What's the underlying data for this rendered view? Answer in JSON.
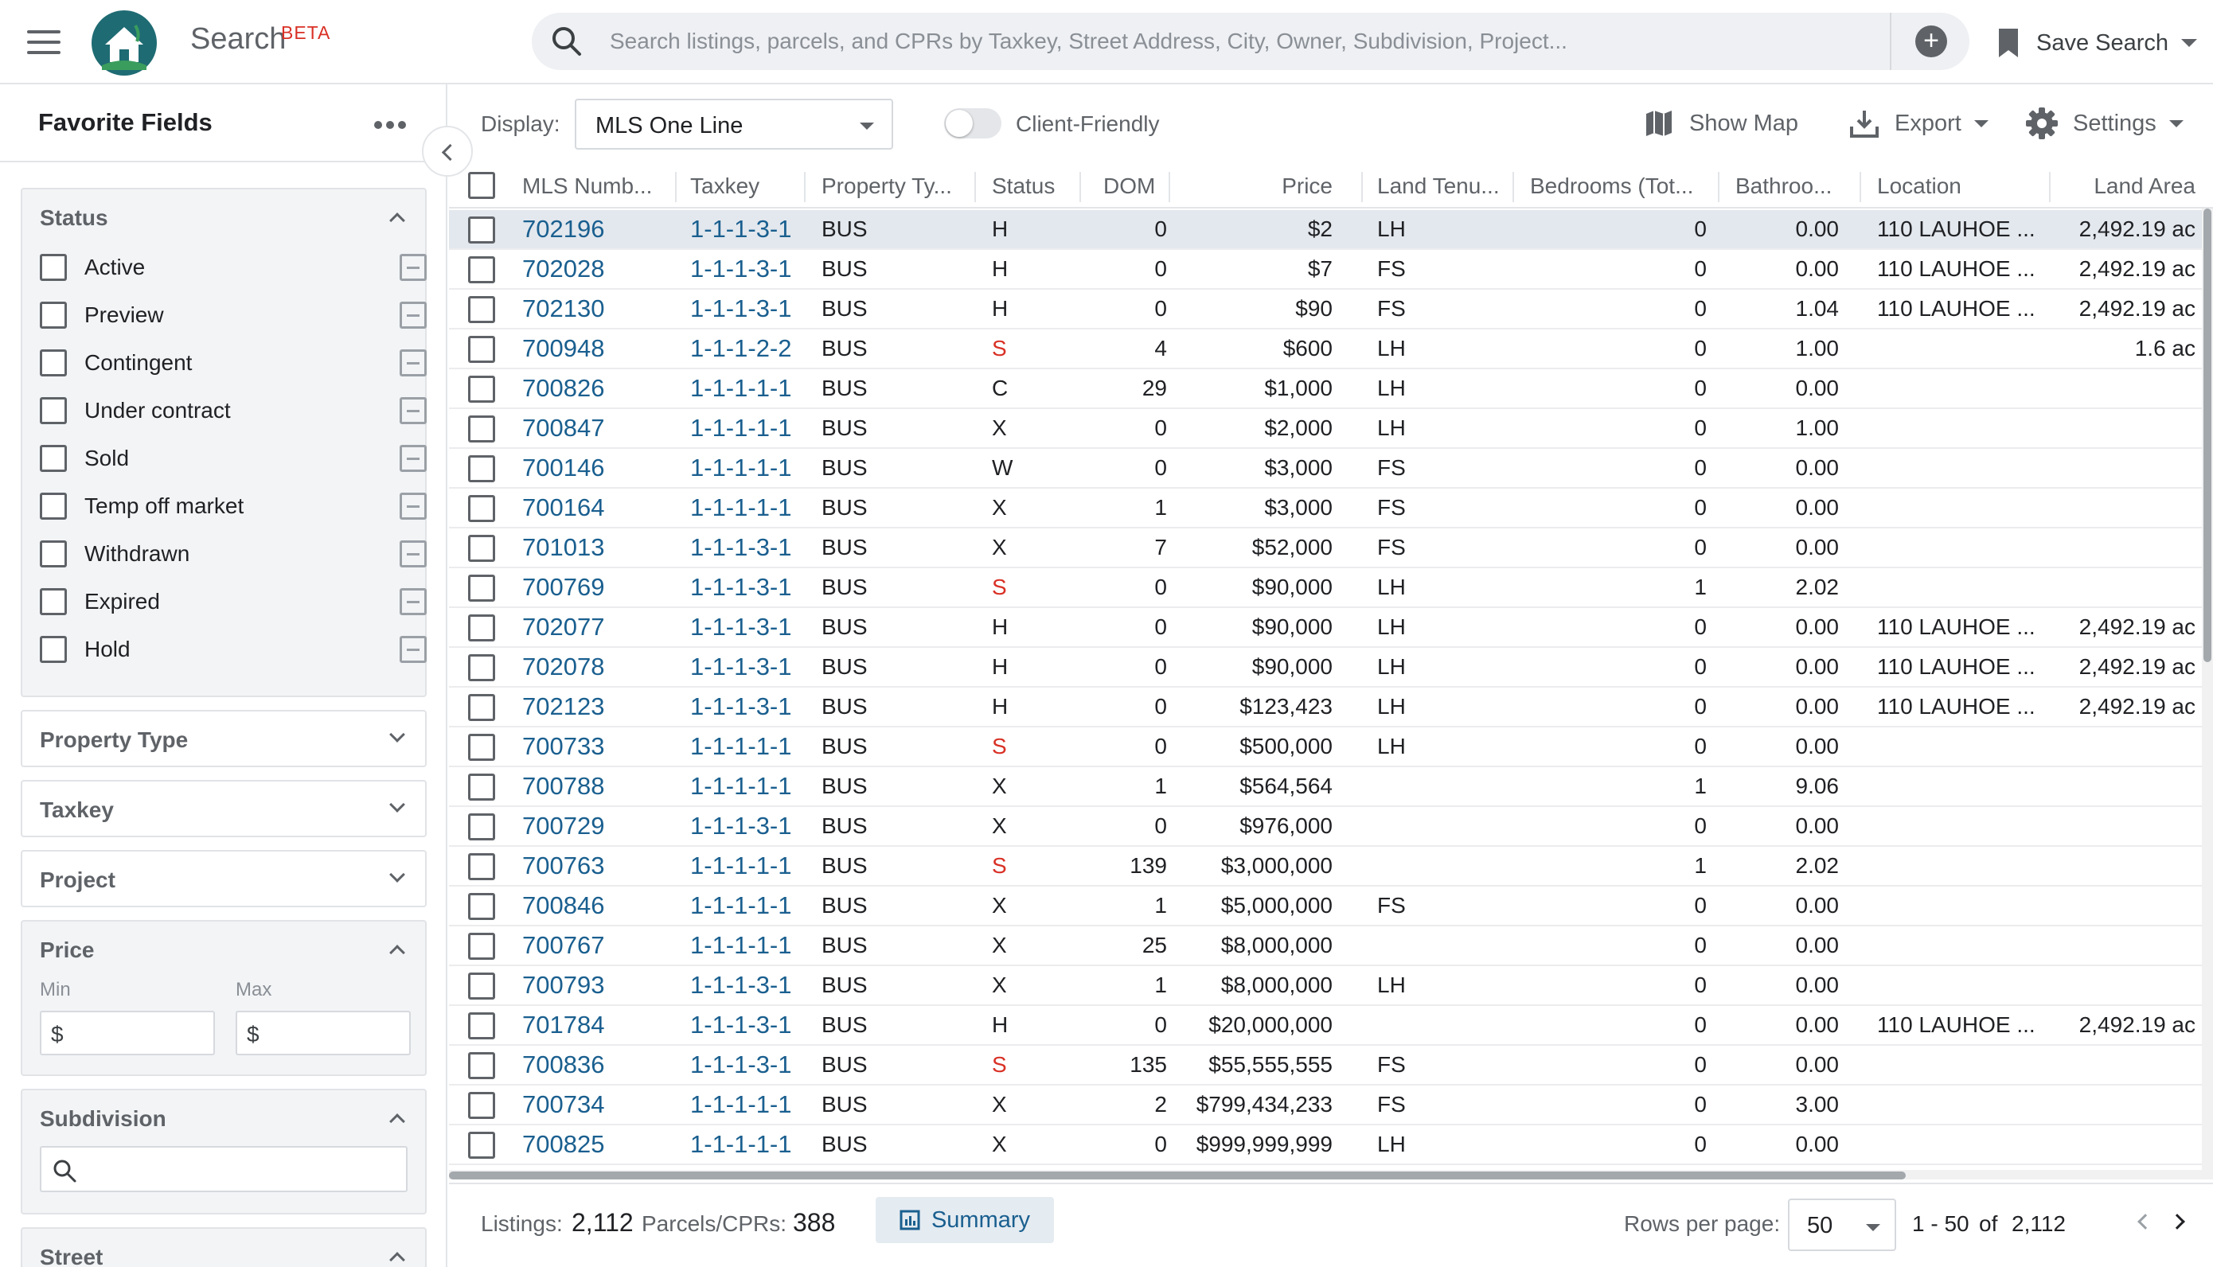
{
  "header": {
    "app_title": "Search",
    "beta_badge": "BETA",
    "search_placeholder": "Search listings, parcels, and CPRs by Taxkey, Street Address, City, Owner, Subdivision, Project...",
    "save_search_label": "Save Search"
  },
  "sidebar": {
    "title": "Favorite Fields",
    "status": {
      "title": "Status",
      "options": [
        "Active",
        "Preview",
        "Contingent",
        "Under contract",
        "Sold",
        "Temp off market",
        "Withdrawn",
        "Expired",
        "Hold"
      ]
    },
    "property_type_title": "Property Type",
    "taxkey_title": "Taxkey",
    "project_title": "Project",
    "price": {
      "title": "Price",
      "min_label": "Min",
      "max_label": "Max",
      "currency": "$"
    },
    "subdivision_title": "Subdivision",
    "street_title": "Street"
  },
  "toolbar": {
    "display_label": "Display:",
    "display_value": "MLS One Line",
    "client_friendly_label": "Client-Friendly",
    "show_map_label": "Show Map",
    "export_label": "Export",
    "settings_label": "Settings"
  },
  "table": {
    "columns": [
      "MLS Numb...",
      "Taxkey",
      "Property Ty...",
      "Status",
      "DOM",
      "Price",
      "Land Tenu...",
      "Bedrooms (Tot...",
      "Bathroo...",
      "Location",
      "Land Area"
    ],
    "rows": [
      {
        "mls": "702196",
        "taxkey": "1-1-1-3-1",
        "ptype": "BUS",
        "status": "H",
        "dom": "0",
        "price": "$2",
        "tenure": "LH",
        "beds": "0",
        "baths": "0.00",
        "location": "110 LAUHOE ...",
        "area": "2,492.19 ac"
      },
      {
        "mls": "702028",
        "taxkey": "1-1-1-3-1",
        "ptype": "BUS",
        "status": "H",
        "dom": "0",
        "price": "$7",
        "tenure": "FS",
        "beds": "0",
        "baths": "0.00",
        "location": "110 LAUHOE ...",
        "area": "2,492.19 ac"
      },
      {
        "mls": "702130",
        "taxkey": "1-1-1-3-1",
        "ptype": "BUS",
        "status": "H",
        "dom": "0",
        "price": "$90",
        "tenure": "FS",
        "beds": "0",
        "baths": "1.04",
        "location": "110 LAUHOE ...",
        "area": "2,492.19 ac"
      },
      {
        "mls": "700948",
        "taxkey": "1-1-1-2-2",
        "ptype": "BUS",
        "status": "S",
        "dom": "4",
        "price": "$600",
        "tenure": "LH",
        "beds": "0",
        "baths": "1.00",
        "location": "",
        "area": "1.6 ac"
      },
      {
        "mls": "700826",
        "taxkey": "1-1-1-1-1",
        "ptype": "BUS",
        "status": "C",
        "dom": "29",
        "price": "$1,000",
        "tenure": "LH",
        "beds": "0",
        "baths": "0.00",
        "location": "",
        "area": ""
      },
      {
        "mls": "700847",
        "taxkey": "1-1-1-1-1",
        "ptype": "BUS",
        "status": "X",
        "dom": "0",
        "price": "$2,000",
        "tenure": "LH",
        "beds": "0",
        "baths": "1.00",
        "location": "",
        "area": ""
      },
      {
        "mls": "700146",
        "taxkey": "1-1-1-1-1",
        "ptype": "BUS",
        "status": "W",
        "dom": "0",
        "price": "$3,000",
        "tenure": "FS",
        "beds": "0",
        "baths": "0.00",
        "location": "",
        "area": ""
      },
      {
        "mls": "700164",
        "taxkey": "1-1-1-1-1",
        "ptype": "BUS",
        "status": "X",
        "dom": "1",
        "price": "$3,000",
        "tenure": "FS",
        "beds": "0",
        "baths": "0.00",
        "location": "",
        "area": ""
      },
      {
        "mls": "701013",
        "taxkey": "1-1-1-3-1",
        "ptype": "BUS",
        "status": "X",
        "dom": "7",
        "price": "$52,000",
        "tenure": "FS",
        "beds": "0",
        "baths": "0.00",
        "location": "",
        "area": ""
      },
      {
        "mls": "700769",
        "taxkey": "1-1-1-3-1",
        "ptype": "BUS",
        "status": "S",
        "dom": "0",
        "price": "$90,000",
        "tenure": "LH",
        "beds": "1",
        "baths": "2.02",
        "location": "",
        "area": ""
      },
      {
        "mls": "702077",
        "taxkey": "1-1-1-3-1",
        "ptype": "BUS",
        "status": "H",
        "dom": "0",
        "price": "$90,000",
        "tenure": "LH",
        "beds": "0",
        "baths": "0.00",
        "location": "110 LAUHOE ...",
        "area": "2,492.19 ac"
      },
      {
        "mls": "702078",
        "taxkey": "1-1-1-3-1",
        "ptype": "BUS",
        "status": "H",
        "dom": "0",
        "price": "$90,000",
        "tenure": "LH",
        "beds": "0",
        "baths": "0.00",
        "location": "110 LAUHOE ...",
        "area": "2,492.19 ac"
      },
      {
        "mls": "702123",
        "taxkey": "1-1-1-3-1",
        "ptype": "BUS",
        "status": "H",
        "dom": "0",
        "price": "$123,423",
        "tenure": "LH",
        "beds": "0",
        "baths": "0.00",
        "location": "110 LAUHOE ...",
        "area": "2,492.19 ac"
      },
      {
        "mls": "700733",
        "taxkey": "1-1-1-1-1",
        "ptype": "BUS",
        "status": "S",
        "dom": "0",
        "price": "$500,000",
        "tenure": "LH",
        "beds": "0",
        "baths": "0.00",
        "location": "",
        "area": ""
      },
      {
        "mls": "700788",
        "taxkey": "1-1-1-1-1",
        "ptype": "BUS",
        "status": "X",
        "dom": "1",
        "price": "$564,564",
        "tenure": "",
        "beds": "1",
        "baths": "9.06",
        "location": "",
        "area": ""
      },
      {
        "mls": "700729",
        "taxkey": "1-1-1-3-1",
        "ptype": "BUS",
        "status": "X",
        "dom": "0",
        "price": "$976,000",
        "tenure": "",
        "beds": "0",
        "baths": "0.00",
        "location": "",
        "area": ""
      },
      {
        "mls": "700763",
        "taxkey": "1-1-1-1-1",
        "ptype": "BUS",
        "status": "S",
        "dom": "139",
        "price": "$3,000,000",
        "tenure": "",
        "beds": "1",
        "baths": "2.02",
        "location": "",
        "area": ""
      },
      {
        "mls": "700846",
        "taxkey": "1-1-1-1-1",
        "ptype": "BUS",
        "status": "X",
        "dom": "1",
        "price": "$5,000,000",
        "tenure": "FS",
        "beds": "0",
        "baths": "0.00",
        "location": "",
        "area": ""
      },
      {
        "mls": "700767",
        "taxkey": "1-1-1-1-1",
        "ptype": "BUS",
        "status": "X",
        "dom": "25",
        "price": "$8,000,000",
        "tenure": "",
        "beds": "0",
        "baths": "0.00",
        "location": "",
        "area": ""
      },
      {
        "mls": "700793",
        "taxkey": "1-1-1-3-1",
        "ptype": "BUS",
        "status": "X",
        "dom": "1",
        "price": "$8,000,000",
        "tenure": "LH",
        "beds": "0",
        "baths": "0.00",
        "location": "",
        "area": ""
      },
      {
        "mls": "701784",
        "taxkey": "1-1-1-3-1",
        "ptype": "BUS",
        "status": "H",
        "dom": "0",
        "price": "$20,000,000",
        "tenure": "",
        "beds": "0",
        "baths": "0.00",
        "location": "110 LAUHOE ...",
        "area": "2,492.19 ac"
      },
      {
        "mls": "700836",
        "taxkey": "1-1-1-3-1",
        "ptype": "BUS",
        "status": "S",
        "dom": "135",
        "price": "$55,555,555",
        "tenure": "FS",
        "beds": "0",
        "baths": "0.00",
        "location": "",
        "area": ""
      },
      {
        "mls": "700734",
        "taxkey": "1-1-1-1-1",
        "ptype": "BUS",
        "status": "X",
        "dom": "2",
        "price": "$799,434,233",
        "tenure": "FS",
        "beds": "0",
        "baths": "3.00",
        "location": "",
        "area": ""
      },
      {
        "mls": "700825",
        "taxkey": "1-1-1-1-1",
        "ptype": "BUS",
        "status": "X",
        "dom": "0",
        "price": "$999,999,999",
        "tenure": "LH",
        "beds": "0",
        "baths": "0.00",
        "location": "",
        "area": ""
      }
    ]
  },
  "footer": {
    "listings_label": "Listings:",
    "listings_count": "2,112",
    "parcels_label": "Parcels/CPRs:",
    "parcels_count": "388",
    "summary_label": "Summary",
    "rows_per_page_label": "Rows per page:",
    "rows_per_page_value": "50",
    "range_text": "1 - 50",
    "of_label": "of",
    "total_text": "2,112"
  },
  "colors": {
    "link": "#1a5f8f",
    "status_sold": "#d93025",
    "beta": "#d93025",
    "selected_row": "#e3e8ee",
    "logo_teal": "#1e6b73"
  },
  "icons": [
    "menu-icon",
    "logo-house-icon",
    "search-icon",
    "add-circle-icon",
    "bookmark-icon",
    "more-horizontal-icon",
    "chevron-left-icon",
    "map-icon",
    "download-icon",
    "gear-icon",
    "bar-chart-icon",
    "chevron-right-icon"
  ]
}
